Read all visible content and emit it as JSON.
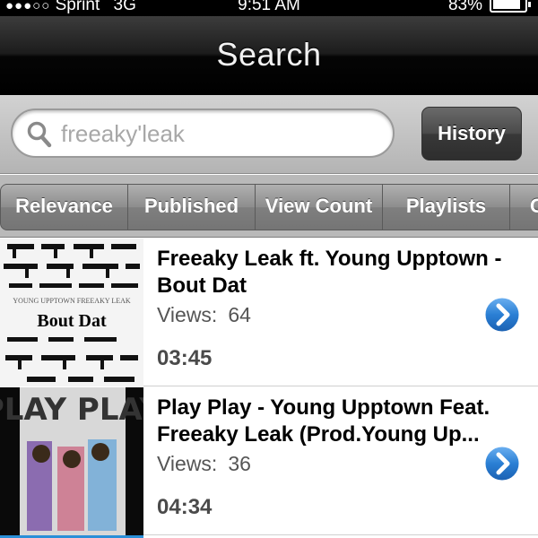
{
  "status_bar": {
    "signal_dots": "●●●○○",
    "carrier": "Sprint",
    "network": "3G",
    "time": "9:51 AM",
    "battery_percent": "83%",
    "battery_level": 0.83
  },
  "nav": {
    "title": "Search"
  },
  "search": {
    "value": "freeaky'leak",
    "history_label": "History"
  },
  "sort_tabs": [
    {
      "label": "Relevance"
    },
    {
      "label": "Published"
    },
    {
      "label": "View Count"
    },
    {
      "label": "Playlists"
    },
    {
      "label": "C"
    }
  ],
  "results": [
    {
      "title": "Freeaky Leak ft. Young Upptown - Bout Dat",
      "views_label": "Views:",
      "views": "64",
      "duration": "03:45",
      "thumb_text": "Bout Dat",
      "thumb_small": "YOUNG UPPTOWN   FREEAKY LEAK"
    },
    {
      "title": "Play Play - Young Upptown Feat. Freeaky Leak (Prod.Young Up...",
      "views_label": "Views:",
      "views": "36",
      "duration": "04:34",
      "thumb_text": "PLAY PLAY"
    }
  ],
  "colors": {
    "nav_bg": "#1c1c1c",
    "accent_blue": "#2a7fd4",
    "tab_gray": "#8d8d8d"
  },
  "icons": {
    "search": "magnifier-icon",
    "disclosure": "chevron-right-circle-icon"
  }
}
